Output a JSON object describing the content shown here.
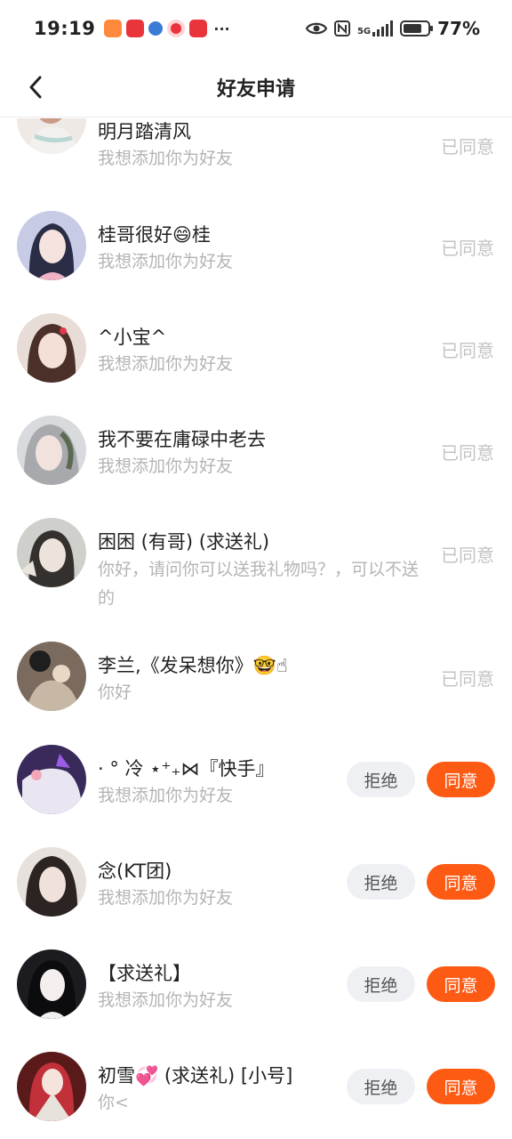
{
  "status_bar": {
    "time": "19:19",
    "notification_icons": [
      "shield-app-icon",
      "kuaishou-app-icon",
      "ball-app-icon",
      "red-circle-app-icon",
      "kuaishou-app-icon"
    ],
    "more": "···",
    "network": "5G",
    "battery": "77%",
    "battery_level": 0.77
  },
  "header": {
    "title": "好友申请"
  },
  "requests": [
    {
      "name": "明月踏清风",
      "message": "我想添加你为好友",
      "status": "已同意",
      "state": "accepted"
    },
    {
      "name": "桂哥很好😄桂",
      "message": "我想添加你为好友",
      "status": "已同意",
      "state": "accepted"
    },
    {
      "name": "^小宝^",
      "message": "我想添加你为好友",
      "status": "已同意",
      "state": "accepted"
    },
    {
      "name": "我不要在庸碌中老去",
      "message": "我想添加你为好友",
      "status": "已同意",
      "state": "accepted"
    },
    {
      "name": "困困 (有哥) (求送礼)",
      "message": "你好，请问你可以送我礼物吗？，可以不送的",
      "status": "已同意",
      "state": "accepted"
    },
    {
      "name": "李兰,《发呆想你》🤓☝",
      "message": "你好",
      "status": "已同意",
      "state": "accepted"
    },
    {
      "name": "· ° 冷 ⋆⁺₊⋈『快手』",
      "message": "我想添加你为好友",
      "reject_label": "拒绝",
      "accept_label": "同意",
      "state": "pending"
    },
    {
      "name": "念(KT团)",
      "message": "我想添加你为好友",
      "reject_label": "拒绝",
      "accept_label": "同意",
      "state": "pending"
    },
    {
      "name": "【求送礼】",
      "message": "我想添加你为好友",
      "reject_label": "拒绝",
      "accept_label": "同意",
      "state": "pending"
    },
    {
      "name": "初雪💞 (求送礼) [小号]",
      "message": "你<",
      "reject_label": "拒绝",
      "accept_label": "同意",
      "state": "pending"
    }
  ],
  "colors": {
    "accent": "#fd5a13",
    "reject_bg": "#eef0f4",
    "muted": "#b4b4b4"
  }
}
